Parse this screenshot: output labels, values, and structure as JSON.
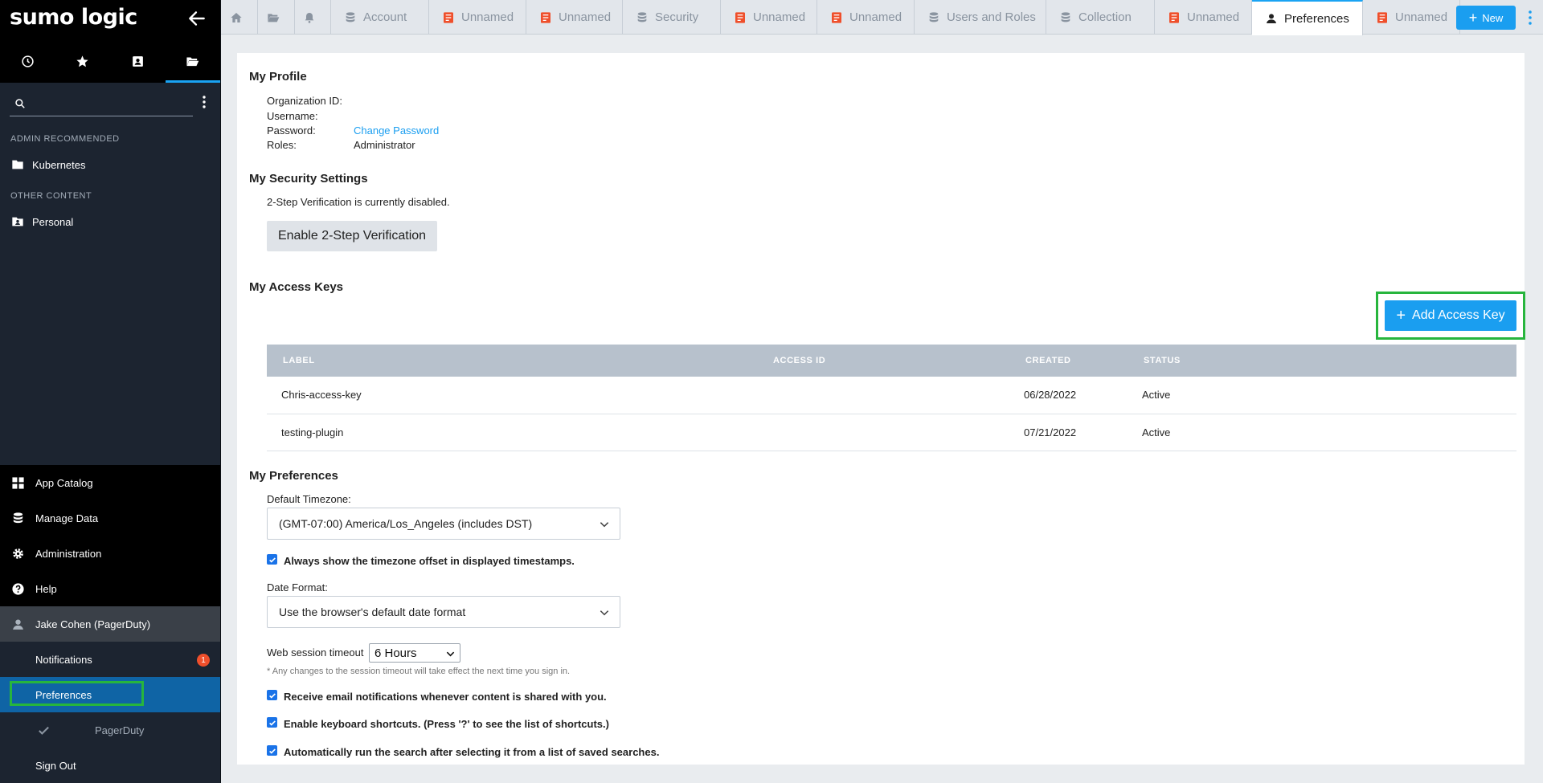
{
  "sidebar": {
    "logo": "sumo logic",
    "tabs": [
      {
        "icon": "clock-icon"
      },
      {
        "icon": "star-icon"
      },
      {
        "icon": "shared-folder-icon"
      },
      {
        "icon": "folder-open-icon"
      }
    ],
    "search_placeholder": "",
    "section_admin": "ADMIN RECOMMENDED",
    "kubernetes": "Kubernetes",
    "section_other": "OTHER CONTENT",
    "personal": "Personal",
    "nav": {
      "app_catalog": "App Catalog",
      "manage_data": "Manage Data",
      "administration": "Administration",
      "help": "Help",
      "user": "Jake Cohen (PagerDuty)",
      "notifications": "Notifications",
      "notifications_count": "1",
      "preferences": "Preferences",
      "pagerduty": "PagerDuty",
      "sign_out": "Sign Out"
    }
  },
  "tabs": [
    {
      "label": "Account",
      "icon": "database-icon"
    },
    {
      "label": "Unnamed",
      "icon": "document-icon"
    },
    {
      "label": "Unnamed",
      "icon": "document-icon"
    },
    {
      "label": "Security",
      "icon": "database-icon"
    },
    {
      "label": "Unnamed",
      "icon": "document-icon"
    },
    {
      "label": "Unnamed",
      "icon": "document-icon"
    },
    {
      "label": "Users and Roles",
      "icon": "database-icon"
    },
    {
      "label": "Collection",
      "icon": "database-icon"
    },
    {
      "label": "Unnamed",
      "icon": "document-icon"
    },
    {
      "label": "Preferences",
      "icon": "user-icon"
    },
    {
      "label": "Unnamed",
      "icon": "document-icon"
    }
  ],
  "new_button": "New",
  "profile": {
    "title": "My Profile",
    "org_id_label": "Organization ID:",
    "username_label": "Username:",
    "password_label": "Password:",
    "password_link": "Change Password",
    "roles_label": "Roles:",
    "roles_value": "Administrator"
  },
  "security": {
    "title": "My Security Settings",
    "status": "2-Step Verification is currently disabled.",
    "enable_button": "Enable 2-Step Verification"
  },
  "access_keys": {
    "title": "My Access Keys",
    "add_button": "Add Access Key",
    "columns": [
      "LABEL",
      "ACCESS ID",
      "CREATED",
      "STATUS"
    ],
    "rows": [
      {
        "label": "Chris-access-key",
        "access_id": "",
        "created": "06/28/2022",
        "status": "Active"
      },
      {
        "label": "testing-plugin",
        "access_id": "",
        "created": "07/21/2022",
        "status": "Active"
      }
    ]
  },
  "preferences": {
    "title": "My Preferences",
    "timezone_label": "Default Timezone:",
    "timezone_value": "(GMT-07:00) America/Los_Angeles (includes DST)",
    "show_offset": "Always show the timezone offset in displayed timestamps.",
    "date_format_label": "Date Format:",
    "date_format_value": "Use the browser's default date format",
    "session_label": "Web session timeout",
    "session_value": "6 Hours",
    "session_note": "* Any changes to the session timeout will take effect the next time you sign in.",
    "email_notify": "Receive email notifications whenever content is shared with you.",
    "keyboard": "Enable keyboard shortcuts. (Press '?' to see the list of shortcuts.)",
    "auto_run": "Automatically run the search after selecting it from a list of saved searches."
  },
  "colors": {
    "accent": "#1a9ef0",
    "highlight": "#27b53d",
    "sidebar_bg": "#1c2430",
    "active_nav": "#0f64a5",
    "badge": "#ef4f2b"
  }
}
